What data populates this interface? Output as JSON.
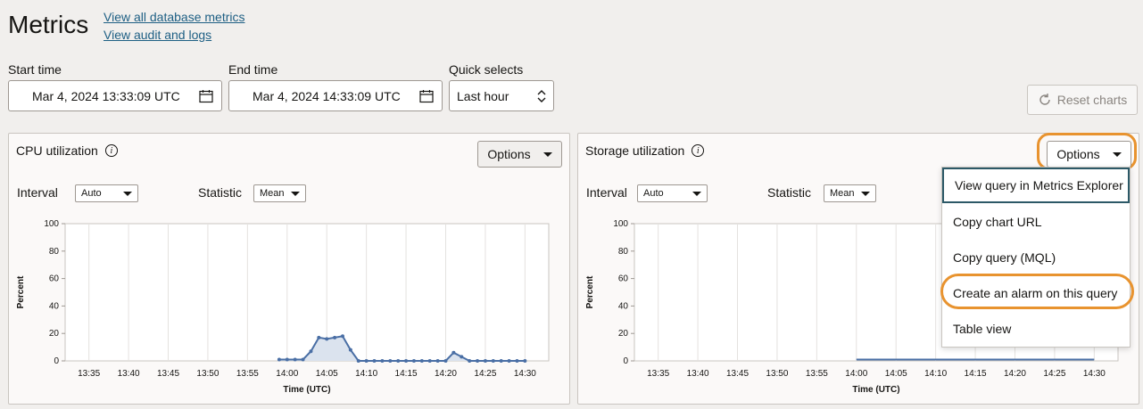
{
  "page": {
    "title": "Metrics",
    "links": [
      "View all database metrics",
      "View audit and logs"
    ]
  },
  "filters": {
    "start_label": "Start time",
    "start_value": "Mar 4, 2024 13:33:09 UTC",
    "end_label": "End time",
    "end_value": "Mar 4, 2024 14:33:09 UTC",
    "quick_label": "Quick selects",
    "quick_value": "Last hour",
    "reset_label": "Reset charts"
  },
  "panels": {
    "cpu": {
      "title": "CPU utilization",
      "options_label": "Options",
      "interval_label": "Interval",
      "interval_value": "Auto",
      "statistic_label": "Statistic",
      "statistic_value": "Mean"
    },
    "storage": {
      "title": "Storage utilization",
      "options_label": "Options",
      "interval_label": "Interval",
      "interval_value": "Auto",
      "statistic_label": "Statistic",
      "statistic_value": "Mean"
    }
  },
  "options_menu": {
    "items": [
      "View query in Metrics Explorer",
      "Copy chart URL",
      "Copy query (MQL)",
      "Create an alarm on this query",
      "Table view"
    ]
  },
  "colors": {
    "line": "#4a6fa5",
    "fill": "#dbe3ee",
    "highlight": "#e8932f"
  },
  "chart_data": [
    {
      "type": "area",
      "xlabel": "Time (UTC)",
      "ylabel": "Percent",
      "ylim": [
        0,
        100
      ],
      "yticks": [
        "100",
        "80",
        "60",
        "40",
        "20",
        "0"
      ],
      "xticks": [
        "13:35",
        "13:40",
        "13:45",
        "13:50",
        "13:55",
        "14:00",
        "14:05",
        "14:10",
        "14:15",
        "14:20",
        "14:25",
        "14:30"
      ],
      "x": [
        "13:59",
        "14:00",
        "14:01",
        "14:02",
        "14:03",
        "14:04",
        "14:05",
        "14:06",
        "14:07",
        "14:08",
        "14:09",
        "14:10",
        "14:11",
        "14:12",
        "14:13",
        "14:14",
        "14:15",
        "14:16",
        "14:17",
        "14:18",
        "14:19",
        "14:20",
        "14:21",
        "14:22",
        "14:23",
        "14:24",
        "14:25",
        "14:26",
        "14:27",
        "14:28",
        "14:29",
        "14:30"
      ],
      "values": [
        1,
        1,
        1,
        1,
        7,
        17,
        16,
        17,
        18,
        8,
        0,
        0,
        0,
        0,
        0,
        0,
        0,
        0,
        0,
        0,
        0,
        0,
        6,
        3,
        0,
        0,
        0,
        0,
        0,
        0,
        0,
        0
      ]
    },
    {
      "type": "line",
      "xlabel": "Time (UTC)",
      "ylabel": "Percent",
      "ylim": [
        0,
        100
      ],
      "yticks": [
        "100",
        "80",
        "60",
        "40",
        "20",
        "0"
      ],
      "xticks": [
        "13:35",
        "13:40",
        "13:45",
        "13:50",
        "13:55",
        "14:00",
        "14:05",
        "14:10",
        "14:15",
        "14:20",
        "14:25",
        "14:30"
      ],
      "x": [
        "14:00",
        "14:30"
      ],
      "values": [
        1,
        1
      ]
    }
  ]
}
